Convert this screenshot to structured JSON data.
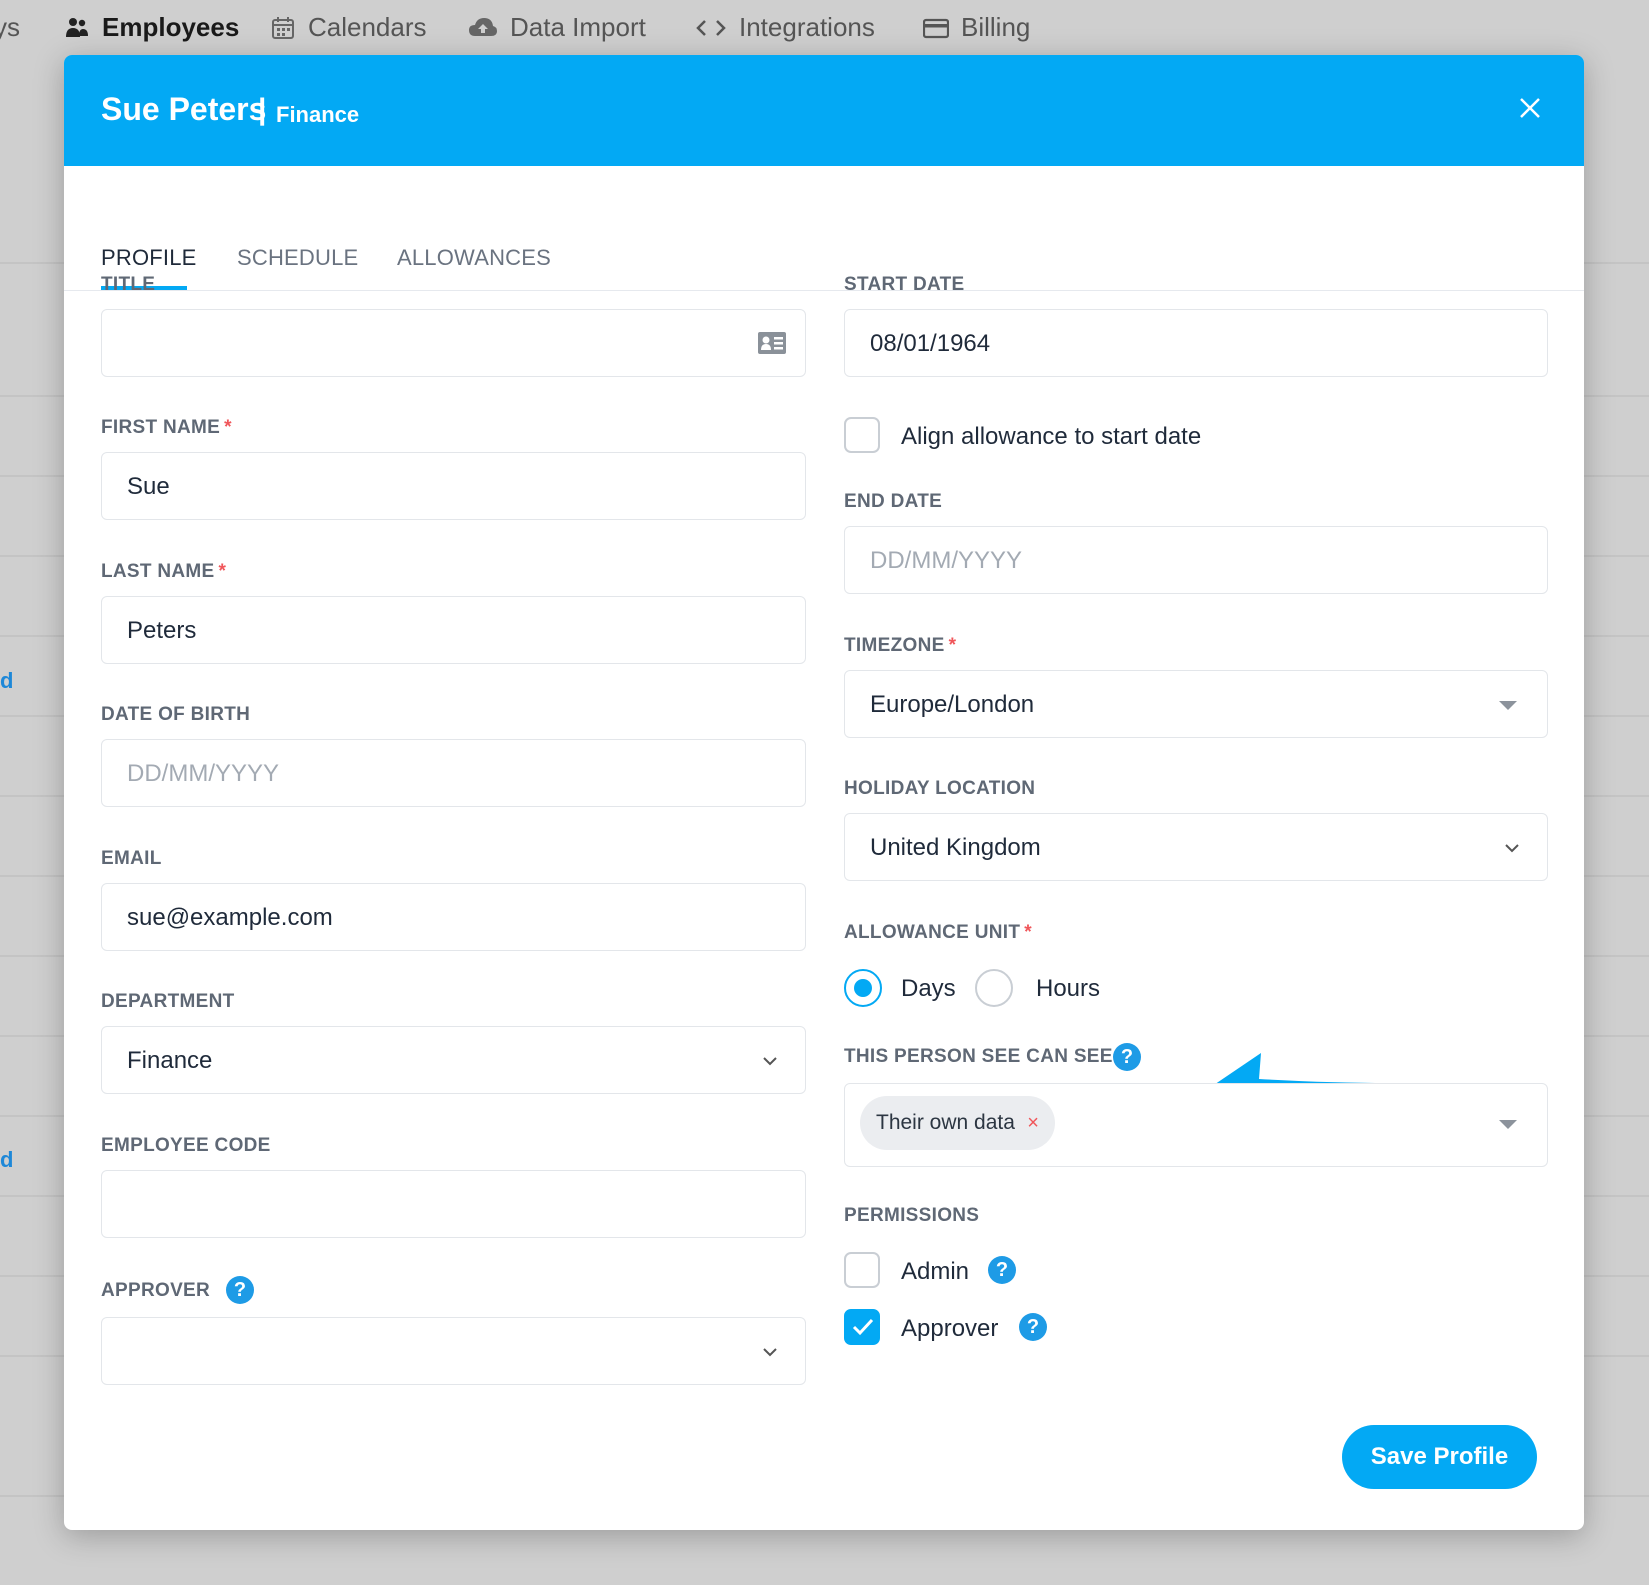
{
  "nav": {
    "partial": "ys",
    "items": [
      {
        "label": "Employees",
        "icon": "users-icon"
      },
      {
        "label": "Calendars",
        "icon": "calendar-icon"
      },
      {
        "label": "Data Import",
        "icon": "cloud-upload-icon"
      },
      {
        "label": "Integrations",
        "icon": "code-icon"
      },
      {
        "label": "Billing",
        "icon": "credit-card-icon"
      }
    ],
    "background_link_fragment": "d"
  },
  "modal": {
    "name": "Sue Peters",
    "separator": "|",
    "department": "Finance"
  },
  "tabs": [
    "PROFILE",
    "SCHEDULE",
    "ALLOWANCES"
  ],
  "left": {
    "title": {
      "label": "TITLE",
      "value": ""
    },
    "first_name": {
      "label": "FIRST NAME",
      "required": "*",
      "value": "Sue"
    },
    "last_name": {
      "label": "LAST NAME",
      "required": "*",
      "value": "Peters"
    },
    "dob": {
      "label": "DATE OF BIRTH",
      "placeholder": "DD/MM/YYYY"
    },
    "email": {
      "label": "EMAIL",
      "value": "sue@example.com"
    },
    "department": {
      "label": "DEPARTMENT",
      "value": "Finance"
    },
    "employee_code": {
      "label": "EMPLOYEE CODE",
      "value": ""
    },
    "approver": {
      "label": "APPROVER",
      "help": "?",
      "value": ""
    }
  },
  "right": {
    "start_date": {
      "label": "START DATE",
      "value": "08/01/1964"
    },
    "align_allowance": {
      "label": "Align allowance to start date",
      "checked": false
    },
    "end_date": {
      "label": "END DATE",
      "placeholder": "DD/MM/YYYY"
    },
    "timezone": {
      "label": "TIMEZONE",
      "required": "*",
      "value": "Europe/London"
    },
    "holiday_location": {
      "label": "HOLIDAY LOCATION",
      "value": "United Kingdom"
    },
    "allowance_unit": {
      "label": "ALLOWANCE UNIT",
      "required": "*",
      "options": [
        "Days",
        "Hours"
      ],
      "selected": "Days"
    },
    "visibility": {
      "label": "THIS PERSON SEE CAN SEE",
      "help": "?",
      "tag": "Their own data",
      "tag_remove": "×"
    },
    "permissions": {
      "label": "PERMISSIONS",
      "admin": {
        "label": "Admin",
        "checked": false,
        "help": "?"
      },
      "approver": {
        "label": "Approver",
        "checked": true,
        "help": "?"
      }
    }
  },
  "save_label": "Save Profile",
  "colors": {
    "accent": "#03a9f4",
    "required": "#f0565a",
    "help": "#1e9be6"
  }
}
